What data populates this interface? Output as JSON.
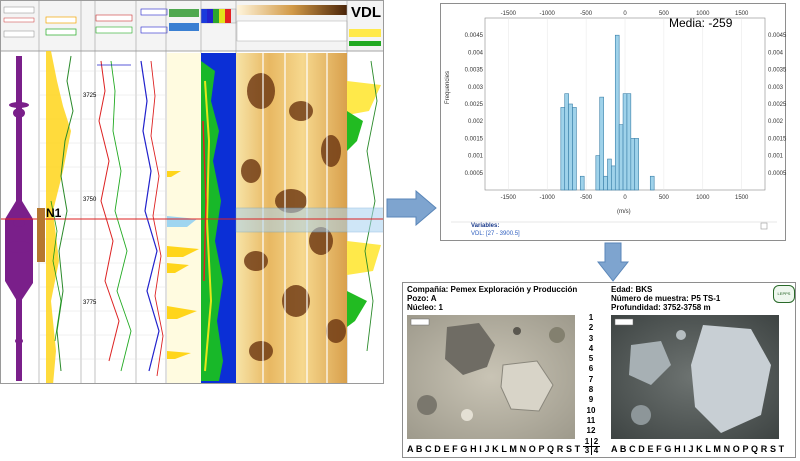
{
  "well_log": {
    "vdl_label": "VDL",
    "n1_label": "N1",
    "depth_ticks": [
      "3725",
      "3750",
      "3775"
    ]
  },
  "histogram": {
    "media_label": "Media: -259",
    "x_ticks": [
      "-1500",
      "-1000",
      "-500",
      "0",
      "500",
      "1000",
      "1500"
    ],
    "y_ticks": [
      "0.0045",
      "0.004",
      "0.0035",
      "0.003",
      "0.0025",
      "0.002",
      "0.0015",
      "0.001",
      "0.0005"
    ],
    "ylabel": "Frequencies",
    "xlabel": "(m/s)",
    "variables_title": "Variables:",
    "variables_value": "VDL: [27 - 3900.5]",
    "bar_color": "#9fd2ea"
  },
  "chart_data": {
    "type": "bar",
    "title": "",
    "xlabel": "(m/s)",
    "ylabel": "Frequencies",
    "xlim": [
      -1800,
      1800
    ],
    "ylim": [
      0,
      0.005
    ],
    "bins": [
      {
        "x0": -825,
        "x1": -775,
        "value": 0.0024
      },
      {
        "x0": -775,
        "x1": -725,
        "value": 0.0028
      },
      {
        "x0": -725,
        "x1": -675,
        "value": 0.0025
      },
      {
        "x0": -675,
        "x1": -625,
        "value": 0.0024
      },
      {
        "x0": -575,
        "x1": -525,
        "value": 0.0004
      },
      {
        "x0": -375,
        "x1": -325,
        "value": 0.001
      },
      {
        "x0": -325,
        "x1": -275,
        "value": 0.0027
      },
      {
        "x0": -275,
        "x1": -225,
        "value": 0.0004
      },
      {
        "x0": -225,
        "x1": -175,
        "value": 0.0009
      },
      {
        "x0": -175,
        "x1": -125,
        "value": 0.0007
      },
      {
        "x0": -125,
        "x1": -75,
        "value": 0.0045
      },
      {
        "x0": -75,
        "x1": -25,
        "value": 0.0019
      },
      {
        "x0": -25,
        "x1": 25,
        "value": 0.0028
      },
      {
        "x0": 25,
        "x1": 75,
        "value": 0.0028
      },
      {
        "x0": 75,
        "x1": 125,
        "value": 0.0015
      },
      {
        "x0": 125,
        "x1": 175,
        "value": 0.0015
      },
      {
        "x0": 325,
        "x1": 375,
        "value": 0.0004
      }
    ]
  },
  "sample": {
    "company_label": "Compañía:  Pemex Exploración y Producción",
    "well_label": "Pozo: A",
    "core_label": "Núcleo: 1",
    "age_label": "Edad: BKS",
    "sample_number_label": "Número de muestra: P5 TS-1",
    "depth_label": "Profundidad: 3752-3758 m",
    "logo_text": "LEPPS",
    "row_numbers": [
      "1",
      "2",
      "3",
      "4",
      "5",
      "6",
      "7",
      "8",
      "9",
      "10",
      "11",
      "12"
    ],
    "letters": "A B C D E F G H I J K L M N O P Q R S T",
    "quadrant": [
      "1",
      "2",
      "3",
      "4"
    ]
  }
}
